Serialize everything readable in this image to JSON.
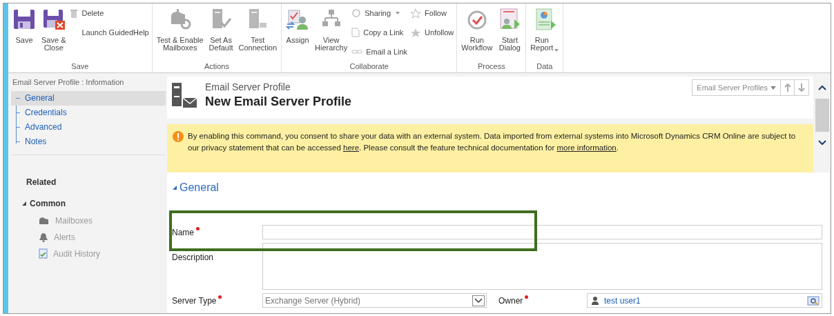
{
  "ribbon": {
    "groups": [
      {
        "label": "Save",
        "items": [
          {
            "kind": "large",
            "label": "Save"
          },
          {
            "kind": "large",
            "label": "Save &\nClose"
          },
          {
            "kind": "column",
            "items": [
              {
                "label": "Delete"
              },
              {
                "label": "Launch GuidedHelp"
              }
            ]
          }
        ]
      },
      {
        "label": "Actions",
        "items": [
          {
            "kind": "large",
            "label": "Test & Enable\nMailboxes"
          },
          {
            "kind": "large",
            "label": "Set As\nDefault"
          },
          {
            "kind": "large",
            "label": "Test\nConnection"
          }
        ]
      },
      {
        "label": "Collaborate",
        "items": [
          {
            "kind": "large",
            "label": "Assign"
          },
          {
            "kind": "large",
            "label": "View\nHierarchy"
          },
          {
            "kind": "column",
            "items": [
              {
                "label": "Sharing",
                "dropdown": true
              },
              {
                "label": "Copy a Link"
              },
              {
                "label": "Email a Link"
              }
            ]
          },
          {
            "kind": "column",
            "items": [
              {
                "label": "Follow"
              },
              {
                "label": "Unfollow"
              }
            ]
          }
        ]
      },
      {
        "label": "Process",
        "items": [
          {
            "kind": "large",
            "label": "Run\nWorkflow"
          },
          {
            "kind": "large",
            "label": "Start\nDialog"
          }
        ]
      },
      {
        "label": "Data",
        "items": [
          {
            "kind": "large",
            "label": "Run\nReport",
            "dropdown": true
          }
        ]
      }
    ]
  },
  "sidebar": {
    "title": "Email Server Profile : Information",
    "nav": [
      {
        "label": "General",
        "selected": true
      },
      {
        "label": "Credentials",
        "selected": false
      },
      {
        "label": "Advanced",
        "selected": false
      },
      {
        "label": "Notes",
        "selected": false
      }
    ],
    "related": {
      "heading": "Related",
      "group": {
        "label": "Common",
        "expanded": true,
        "items": [
          {
            "label": "Mailboxes"
          },
          {
            "label": "Alerts"
          },
          {
            "label": "Audit History"
          }
        ]
      }
    }
  },
  "header": {
    "entity": "Email Server Profile",
    "title": "New Email Server Profile",
    "view_selector": "Email Server Profiles"
  },
  "notice": {
    "parts": [
      {
        "kind": "text",
        "text": "By enabling this command, you consent to share your data with an external system. Data imported from external systems into Microsoft Dynamics CRM Online are subject to our privacy statement that can be accessed "
      },
      {
        "kind": "link",
        "text": "here"
      },
      {
        "kind": "text",
        "text": ". Please consult the feature technical documentation for "
      },
      {
        "kind": "link",
        "text": "more information"
      },
      {
        "kind": "text",
        "text": "."
      }
    ]
  },
  "section": {
    "title": "General",
    "expanded": true
  },
  "fields": {
    "name": {
      "label": "Name",
      "required": true
    },
    "description": {
      "label": "Description"
    },
    "server_type": {
      "label": "Server Type",
      "required": true,
      "value": "Exchange Server (Hybrid)"
    },
    "owner": {
      "label": "Owner",
      "required": true,
      "value": "test user1"
    }
  },
  "highlight": {
    "on": true
  }
}
